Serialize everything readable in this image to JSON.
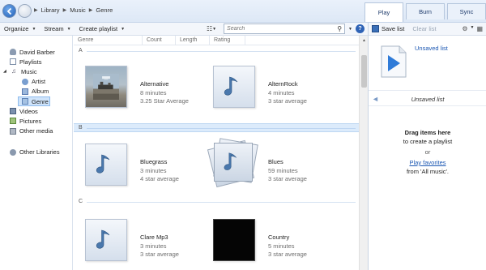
{
  "breadcrumb": [
    "Library",
    "Music",
    "Genre"
  ],
  "tabs": [
    {
      "label": "Play",
      "active": true
    },
    {
      "label": "Burn",
      "active": false
    },
    {
      "label": "Sync",
      "active": false
    }
  ],
  "toolbar": {
    "organize": "Organize",
    "stream": "Stream",
    "create_playlist": "Create playlist",
    "search_placeholder": "Search"
  },
  "right_panel": {
    "save_list": "Save list",
    "clear_list": "Clear list",
    "list_name": "Unsaved list",
    "subtitle": "Unsaved list",
    "drag_title": "Drag items here",
    "drag_sub": "to create a playlist",
    "or": "or",
    "play_favorites": "Play favorites",
    "from": "from 'All music'."
  },
  "nav": {
    "user": "David Barber",
    "playlists": "Playlists",
    "music": "Music",
    "artist": "Artist",
    "album": "Album",
    "genre": "Genre",
    "videos": "Videos",
    "pictures": "Pictures",
    "other_media": "Other media",
    "other_libraries": "Other Libraries"
  },
  "columns": [
    "Genre",
    "Count",
    "Length",
    "Rating"
  ],
  "groups": [
    {
      "letter": "A",
      "items": [
        {
          "title": "Alternative",
          "duration": "8 minutes",
          "rating": "3.25 Star Average",
          "art": "photo"
        },
        {
          "title": "AlternRock",
          "duration": "4 minutes",
          "rating": "3 star average",
          "art": "note"
        }
      ]
    },
    {
      "letter": "B",
      "items": [
        {
          "title": "Bluegrass",
          "duration": "3 minutes",
          "rating": "4 star average",
          "art": "note"
        },
        {
          "title": "Blues",
          "duration": "59 minutes",
          "rating": "3 star average",
          "art": "stack"
        }
      ]
    },
    {
      "letter": "C",
      "items": [
        {
          "title": "Clare Mp3",
          "duration": "3 minutes",
          "rating": "3 star average",
          "art": "note"
        },
        {
          "title": "Country",
          "duration": "5 minutes",
          "rating": "3 star average",
          "art": "black"
        }
      ]
    }
  ]
}
